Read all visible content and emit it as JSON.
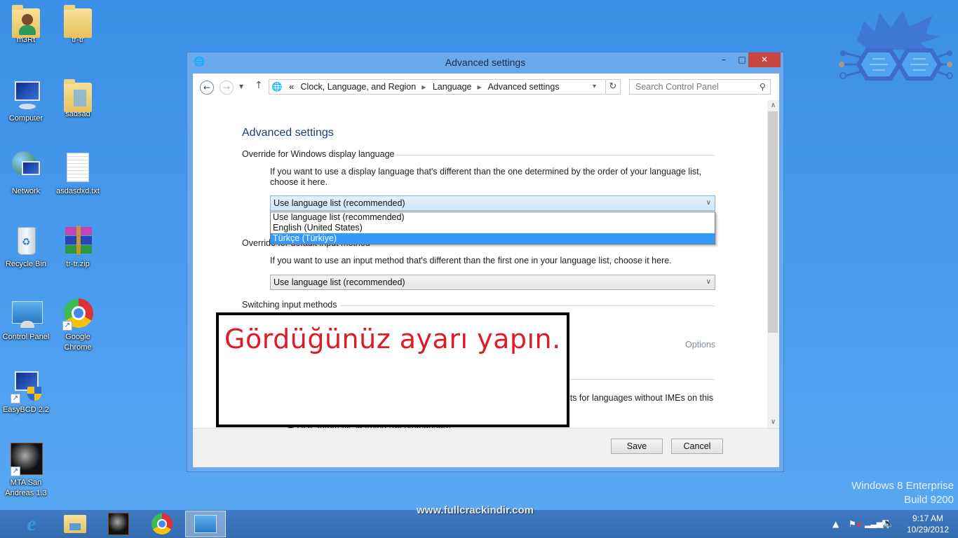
{
  "desktop": {
    "icons": [
      {
        "label": "m3Rt",
        "icon": "user-folder-icon"
      },
      {
        "label": "tr-tr",
        "icon": "folder-icon"
      },
      {
        "label": "Computer",
        "icon": "computer-icon"
      },
      {
        "label": "sadsad",
        "icon": "folder-icon"
      },
      {
        "label": "Network",
        "icon": "network-icon"
      },
      {
        "label": "asdasdxd.txt",
        "icon": "text-file-icon"
      },
      {
        "label": "Recycle Bin",
        "icon": "recycle-bin-icon"
      },
      {
        "label": "tr-tr.zip",
        "icon": "winrar-archive-icon"
      },
      {
        "label": "Control Panel",
        "icon": "control-panel-icon"
      },
      {
        "label": "Google Chrome",
        "icon": "chrome-icon"
      },
      {
        "label": "EasyBCD 2.2",
        "icon": "easybcd-icon"
      },
      {
        "label": "MTA San Andreas 1.3",
        "icon": "mta-icon"
      }
    ],
    "os_edition": "Windows 8 Enterprise",
    "os_build": "Build 9200",
    "watermark": "www.fullcrackindir.com"
  },
  "window": {
    "title": "Advanced settings",
    "minimize_glyph": "–",
    "maximize_glyph": "□",
    "close_glyph": "✕",
    "nav": {
      "back": "←",
      "forward": "→",
      "recent": "▾",
      "up": "↑",
      "overflow": "«",
      "breadcrumb": [
        "Clock, Language, and Region",
        "Language",
        "Advanced settings"
      ],
      "refresh": "↻",
      "search_placeholder": "Search Control Panel"
    },
    "page_title": "Advanced settings",
    "sections": {
      "display_language": {
        "heading": "Override for Windows display language",
        "description": "If you want to use a display language that's different than the one determined by the order of your language list, choose it here.",
        "selected": "Use language list (recommended)",
        "options": [
          "Use language list (recommended)",
          "English (United States)",
          "Türkçe (Türkiye)"
        ],
        "highlighted_index": 2
      },
      "input_method": {
        "heading": "Override for default input method",
        "description": "If you want to use an input method that's different than the first one in your language list, choose it here.",
        "selected": "Use language list (recommended)"
      },
      "switching": {
        "heading": "Switching input methods",
        "options_link": "Options"
      },
      "partial_text": "ults for languages without IMEs on this",
      "partial_radio": "Use automatic learning (recommended)"
    },
    "buttons": {
      "save": "Save",
      "cancel": "Cancel"
    }
  },
  "annotation": {
    "text": "Gördüğünüz ayarı yapın.",
    "color": "#dd1c2a"
  },
  "taskbar": {
    "items": [
      {
        "name": "internet-explorer"
      },
      {
        "name": "file-explorer"
      },
      {
        "name": "mta-san-andreas"
      },
      {
        "name": "google-chrome"
      },
      {
        "name": "control-panel",
        "active": true
      }
    ],
    "tray": {
      "show_hidden": "▲",
      "time": "9:17 AM",
      "date": "10/29/2012"
    }
  }
}
